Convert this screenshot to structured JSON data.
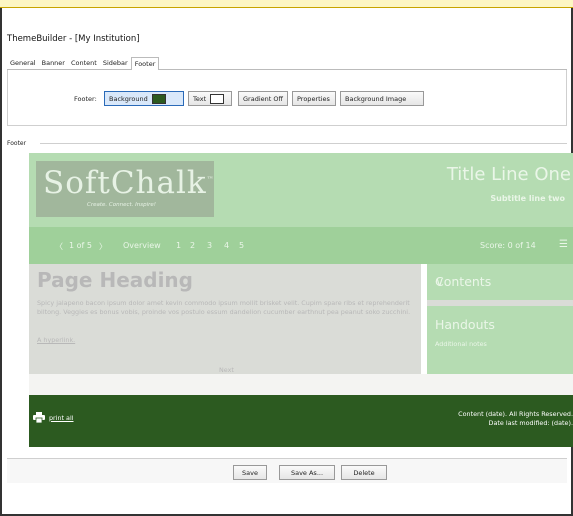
{
  "window": {
    "title": "ThemeBuilder - [My Institution]"
  },
  "tabs": [
    "General",
    "Banner",
    "Content",
    "Sidebar",
    "Footer"
  ],
  "active_tab": "Footer",
  "toolbar": {
    "label": "Footer:",
    "background_btn": "Background",
    "background_color": "#2c5a20",
    "text_btn": "Text",
    "text_color": "#ffffff",
    "gradient_btn": "Gradient Off",
    "properties_btn": "Properties",
    "bg_image_btn": "Background Image"
  },
  "group_label": "Footer",
  "preview": {
    "logo": "SoftChalk",
    "logo_trademark": "™",
    "logo_tagline": "Create. Connect. Inspire!",
    "title_line_one": "Title Line One",
    "subtitle": "Subtitle line two",
    "nav": {
      "prev": "〈",
      "page": "1 of 5",
      "next": "〉",
      "overview": "Overview",
      "pages": [
        "1",
        "2",
        "3",
        "4",
        "5"
      ],
      "score": "Score: 0 of 14",
      "menu_icon": "☰"
    },
    "heading": "Page Heading",
    "paragraph": "Spicy jalapeno bacon ipsum dolor amet kevin commodo ipsum mollit brisket velit. Cupim spare ribs et reprehenderit biltong. Veggies es bonus vobis, proinde vos postulo essum dandelion cucumber earthnut pea peanut soko zucchini.",
    "hyperlink": "A hyperlink.",
    "next_label": "Next",
    "sidebar_contents": "Contents",
    "sidebar_chevron": "∨",
    "handouts_title": "Handouts",
    "handouts_note": "Additional notes",
    "footer_print": "print all",
    "footer_right_line1": "Content (date). All Rights Reserved.",
    "footer_right_line2": "Date last modified: (date)."
  },
  "colors": {
    "banner": "#b5dcb2",
    "navbar": "#9fd09a",
    "content_bg": "#dadcd7",
    "footer_bg": "#2c5a20"
  },
  "buttons": {
    "save": "Save",
    "save_as": "Save As...",
    "delete": "Delete"
  }
}
